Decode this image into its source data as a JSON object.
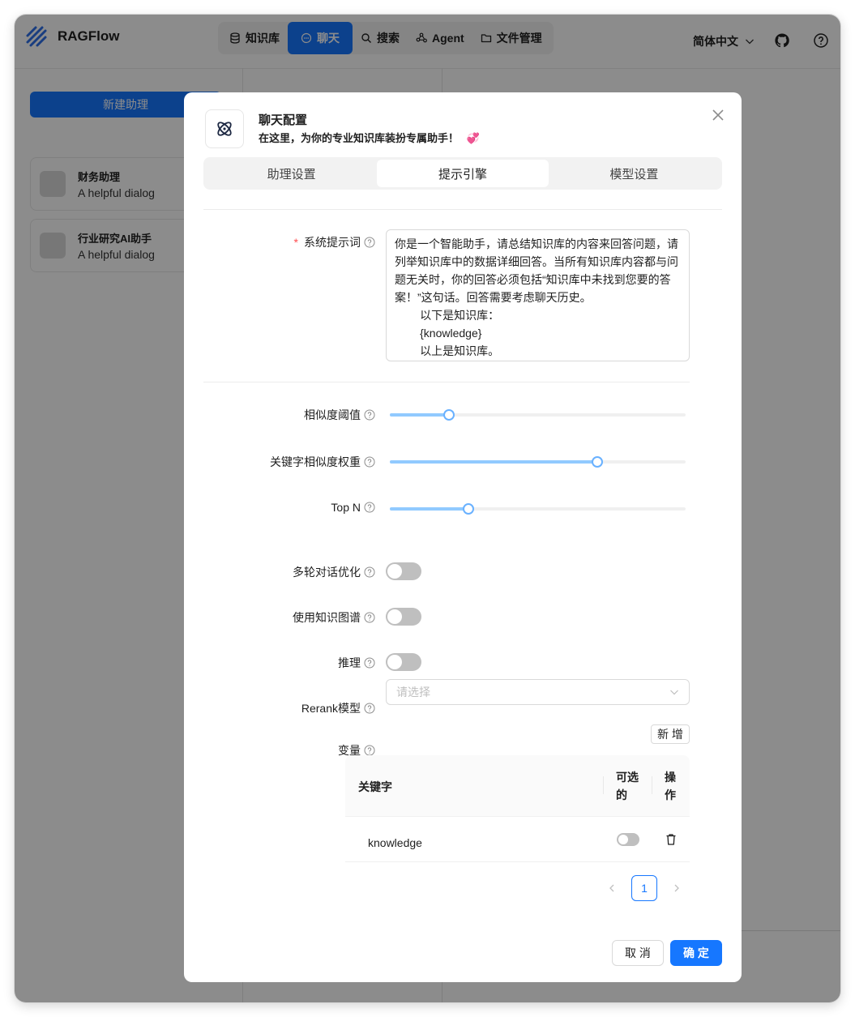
{
  "app": {
    "name": "RAGFlow"
  },
  "nav": {
    "items": [
      {
        "label": "知识库",
        "icon": "database-icon"
      },
      {
        "label": "聊天",
        "icon": "chat-icon",
        "active": true
      },
      {
        "label": "搜索",
        "icon": "search-icon"
      },
      {
        "label": "Agent",
        "icon": "agent-graph-icon"
      },
      {
        "label": "文件管理",
        "icon": "folder-icon"
      }
    ],
    "language": "简体中文"
  },
  "sidebar": {
    "new_button": "新建助理",
    "assistants": [
      {
        "name": "财务助理",
        "desc": "A helpful dialog"
      },
      {
        "name": "行业研究AI助手",
        "desc": "A helpful dialog"
      }
    ]
  },
  "modal": {
    "title": "聊天配置",
    "subtitle": "在这里，为你的专业知识库装扮专属助手！",
    "emoji": "💞",
    "tabs": [
      "助理设置",
      "提示引擎",
      "模型设置"
    ],
    "active_tab": 1,
    "system_prompt": {
      "label": "系统提示词",
      "required_mark": "*",
      "value": "你是一个智能助手，请总结知识库的内容来回答问题，请列举知识库中的数据详细回答。当所有知识库内容都与问题无关时，你的回答必须包括“知识库中未找到您要的答案！”这句话。回答需要考虑聊天历史。\n        以下是知识库：\n        {knowledge}\n        以上是知识库。"
    },
    "sliders": [
      {
        "label": "相似度阈值",
        "value": 0.2
      },
      {
        "label": "关键字相似度权重",
        "value": 0.7
      },
      {
        "label": "Top N",
        "value": 8,
        "max": 30
      }
    ],
    "switches": [
      {
        "label": "多轮对话优化",
        "on": false
      },
      {
        "label": "使用知识图谱",
        "on": false
      },
      {
        "label": "推理",
        "on": false
      }
    ],
    "rerank": {
      "label": "Rerank模型",
      "placeholder": "请选择"
    },
    "variables": {
      "label": "变量",
      "add_button": "新 增",
      "columns": [
        "关键字",
        "可选的",
        "操作"
      ],
      "rows": [
        {
          "key": "knowledge",
          "optional": false
        }
      ],
      "page": "1"
    },
    "buttons": {
      "cancel": "取 消",
      "ok": "确 定"
    }
  },
  "colors": {
    "primary": "#1677ff",
    "slider_track": "#91caff",
    "required": "#ff4d4f"
  }
}
